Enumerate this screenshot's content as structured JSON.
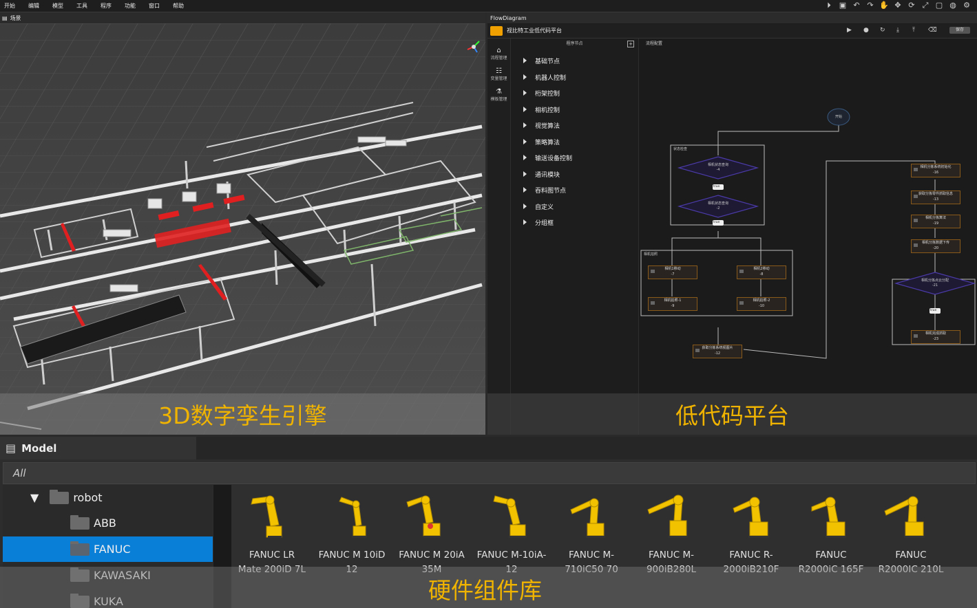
{
  "menubar": {
    "items": [
      "开始",
      "编辑",
      "模型",
      "工具",
      "程序",
      "功能",
      "窗口",
      "帮助"
    ]
  },
  "scene": {
    "tab_title": "场景",
    "caption": "3D数字孪生引擎"
  },
  "flow": {
    "tab_title": "FlowDiagram",
    "app_title": "视比特工业低代码平台",
    "button_label": "保存",
    "left_bar": [
      "流程管理",
      "变量管理",
      "模板管理"
    ],
    "node_lib_title": "程序节点",
    "node_lib_items": [
      "基础节点",
      "机器人控制",
      "桁架控制",
      "相机控制",
      "视觉算法",
      "策略算法",
      "输送设备控制",
      "通讯模块",
      "吞料图节点",
      "自定义",
      "分组框"
    ],
    "canvas_label": "流程配置",
    "start_label": "开始",
    "group1_label": "状态检查",
    "group2_label": "相机拍照",
    "diamond1": [
      "相机状态查询",
      "-4"
    ],
    "diamond2": [
      "相机状态查询",
      "-2"
    ],
    "true_label": "true",
    "nodes_left": [
      [
        "相机1移动",
        "-7"
      ],
      [
        "相机2移动",
        "-8"
      ],
      [
        "相机拍照-1",
        "-9"
      ],
      [
        "相机拍照-2",
        "-10"
      ],
      [
        "获取分拣系统视图片",
        "-12"
      ]
    ],
    "nodes_right": [
      [
        "相机分拣系统初始化",
        "-16"
      ],
      [
        "获取分拣零件抓取信息",
        "-13"
      ],
      [
        "相机分拣算法",
        "-19"
      ],
      [
        "相机分拣数据下传",
        "-20"
      ],
      [
        "相机分拣点云分配",
        "-21"
      ],
      [
        "相机完成抓取",
        "-23"
      ]
    ],
    "caption": "低代码平台"
  },
  "model": {
    "title": "Model",
    "filter": "All",
    "tree": [
      {
        "label": "robot",
        "level": 0,
        "expanded": true
      },
      {
        "label": "ABB",
        "level": 1
      },
      {
        "label": "FANUC",
        "level": 1,
        "selected": true
      },
      {
        "label": "KAWASAKI",
        "level": 1
      },
      {
        "label": "KUKA",
        "level": 1
      }
    ],
    "assets": [
      [
        "FANUC LR",
        "Mate 200iD 7L"
      ],
      [
        "FANUC M 10iD",
        "12"
      ],
      [
        "FANUC M 20iA",
        "35M"
      ],
      [
        "FANUC M-10iA-",
        "12"
      ],
      [
        "FANUC M-",
        "710iC50 70"
      ],
      [
        "FANUC M-",
        "900iB280L"
      ],
      [
        "FANUC R-",
        "2000iB210F"
      ],
      [
        "FANUC",
        "R2000iC 165F"
      ],
      [
        "FANUC",
        "R2000IC 210L"
      ]
    ],
    "caption": "硬件组件库"
  },
  "colors": {
    "caption": "#f0b400",
    "selected": "#0a7fd8",
    "robot_yellow": "#f2c200",
    "flow_node_border": "#8a5a1a",
    "diamond": "#4a3aa8"
  }
}
